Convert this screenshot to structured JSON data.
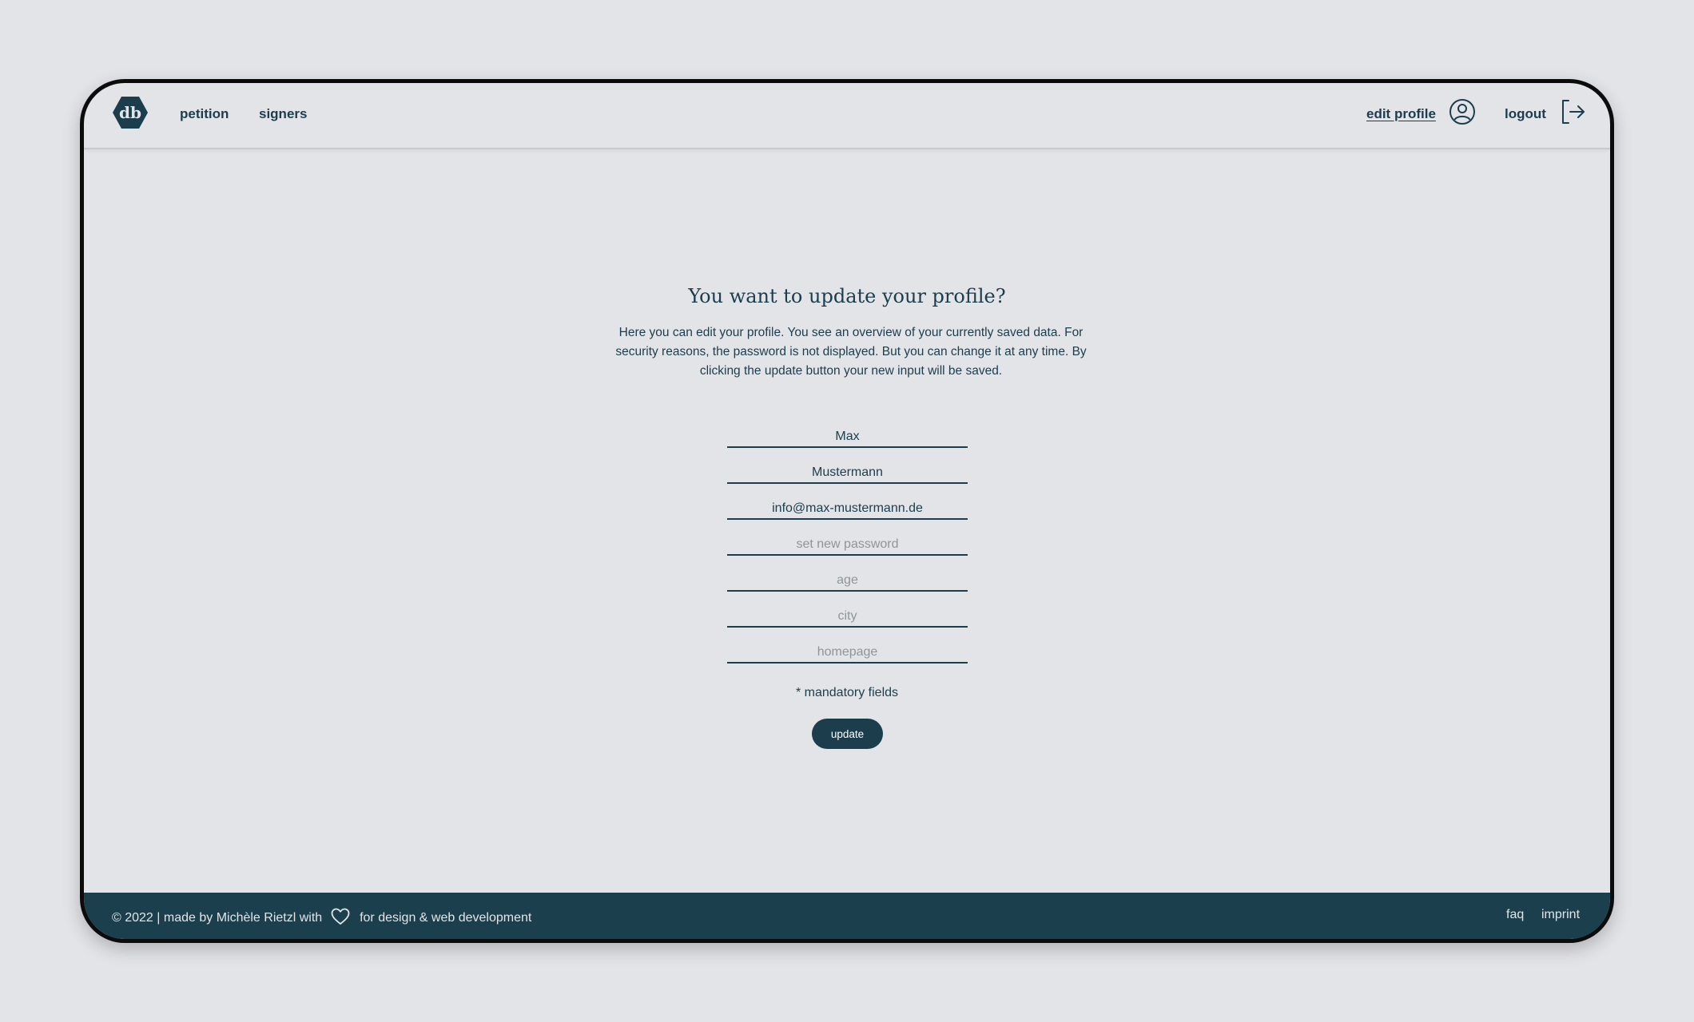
{
  "header": {
    "logo_text": "db",
    "nav": {
      "petition": "petition",
      "signers": "signers",
      "edit_profile": "edit profile",
      "logout": "logout"
    }
  },
  "main": {
    "title": "You want to update your profile?",
    "intro": "Here you can edit your profile. You see an overview of your currently saved data. For security reasons, the password is not displayed. But you can change it at any time. By clicking the update button your new input will be saved.",
    "fields": {
      "first_name": {
        "value": "Max"
      },
      "last_name": {
        "value": "Mustermann"
      },
      "email": {
        "value": "info@max-mustermann.de"
      },
      "password": {
        "value": "",
        "placeholder": "set new password"
      },
      "age": {
        "value": "",
        "placeholder": "age"
      },
      "city": {
        "value": "",
        "placeholder": "city"
      },
      "homepage": {
        "value": "",
        "placeholder": "homepage"
      }
    },
    "mandatory_note": "* mandatory fields",
    "update_label": "update"
  },
  "footer": {
    "credit_prefix": "© 2022 | made by Michèle Rietzl with",
    "credit_suffix": "for design & web development",
    "faq": "faq",
    "imprint": "imprint"
  },
  "icons": {
    "logo": "hexagon-logo-icon",
    "user": "user-circle-icon",
    "logout": "logout-arrow-icon",
    "heart": "heart-outline-icon"
  },
  "colors": {
    "primary": "#1b3d4c",
    "background": "#e3e4e8",
    "footer": "#1b3f4d",
    "frame_border": "#0c0c0c",
    "placeholder": "#8e9598"
  }
}
